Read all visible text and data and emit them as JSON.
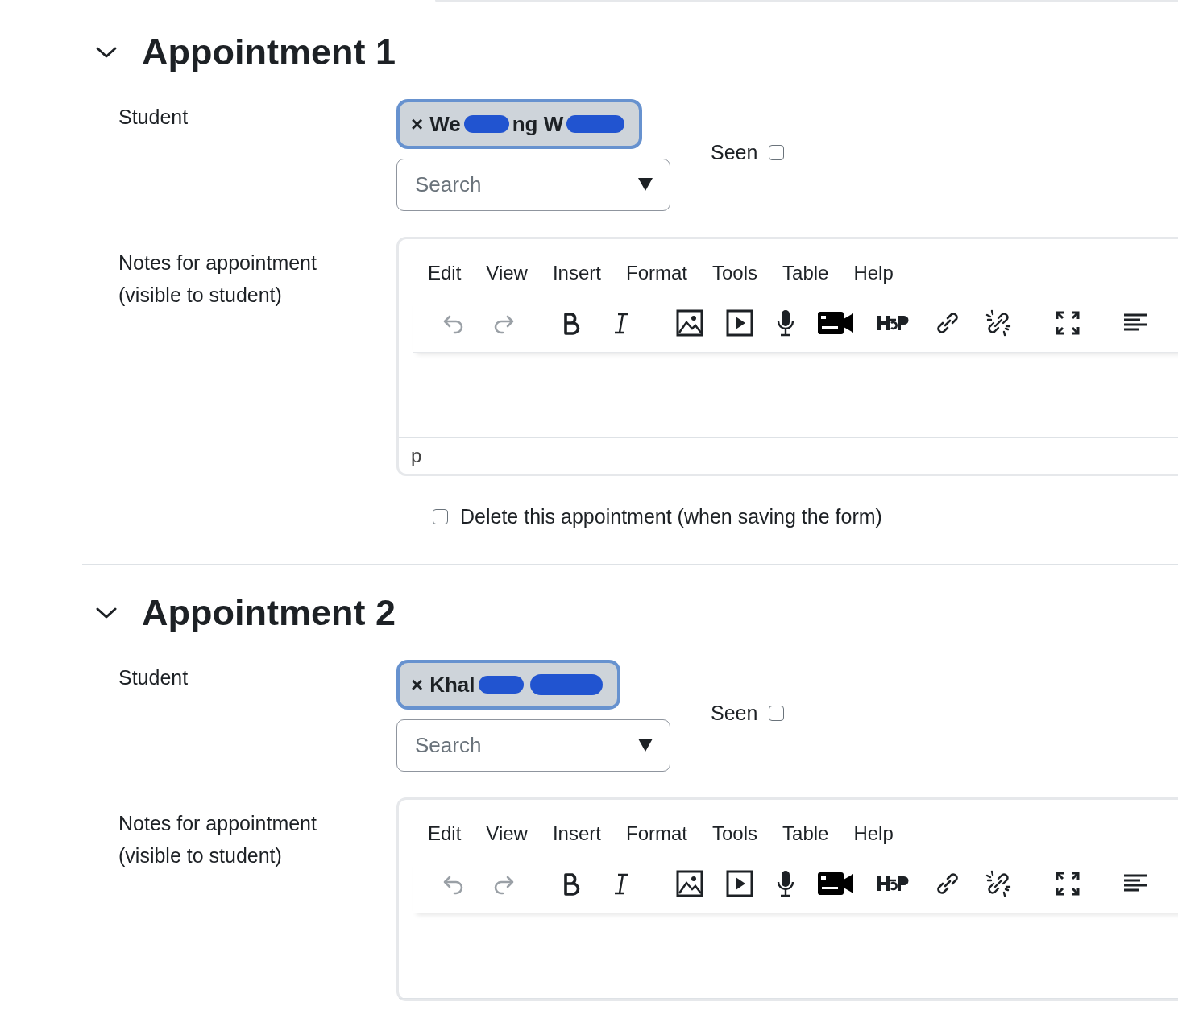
{
  "appointments": [
    {
      "title": "Appointment 1",
      "expanded": true,
      "student_label": "Student",
      "remove": "×",
      "student_chip": [
        {
          "kind": "text",
          "text": "We"
        },
        {
          "kind": "redaction"
        },
        {
          "kind": "text",
          "text": "ng W"
        },
        {
          "kind": "redaction"
        }
      ],
      "search": {
        "placeholder": "Search"
      },
      "seen": {
        "label": "Seen",
        "checked": false
      },
      "notes_label": "Notes for appointment (visible to student)",
      "editor": {
        "menu": [
          "Edit",
          "View",
          "Insert",
          "Format",
          "Tools",
          "Table",
          "Help"
        ],
        "status": "p"
      },
      "delete": {
        "label": "Delete this appointment (when saving the form)",
        "checked": false
      }
    },
    {
      "title": "Appointment 2",
      "expanded": true,
      "student_label": "Student",
      "remove": "×",
      "student_chip": [
        {
          "kind": "text",
          "text": "Khal"
        },
        {
          "kind": "redaction"
        },
        {
          "kind": "redaction"
        }
      ],
      "search": {
        "placeholder": "Search"
      },
      "seen": {
        "label": "Seen",
        "checked": false
      },
      "notes_label": "Notes for appointment (visible to student)",
      "editor": {
        "menu": [
          "Edit",
          "View",
          "Insert",
          "Format",
          "Tools",
          "Table",
          "Help"
        ]
      }
    }
  ]
}
